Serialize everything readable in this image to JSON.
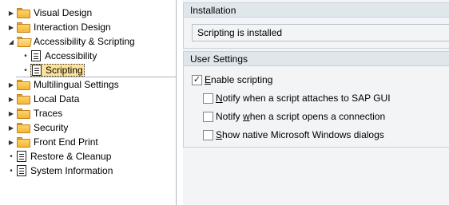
{
  "tree": {
    "items": [
      {
        "label": "Visual Design"
      },
      {
        "label": "Interaction Design"
      },
      {
        "label": "Accessibility & Scripting"
      },
      {
        "label": "Accessibility"
      },
      {
        "label": "Scripting"
      },
      {
        "label": "Multilingual Settings"
      },
      {
        "label": "Local Data"
      },
      {
        "label": "Traces"
      },
      {
        "label": "Security"
      },
      {
        "label": "Front End Print"
      },
      {
        "label": "Restore & Cleanup"
      },
      {
        "label": "System Information"
      }
    ]
  },
  "installation": {
    "title": "Installation",
    "status": "Scripting is installed"
  },
  "user_settings": {
    "title": "User Settings",
    "enable_scripting": {
      "label_first": "E",
      "label_rest": "nable scripting",
      "checked": true
    },
    "notify_attach": {
      "label_first": "N",
      "label_rest": "otify when a script attaches to SAP GUI",
      "checked": false
    },
    "notify_open": {
      "label_pre": "Notify ",
      "label_ul": "w",
      "label_rest": "hen a script opens a connection",
      "checked": false
    },
    "show_dialogs": {
      "label_first": "S",
      "label_rest": "how native Microsoft Windows dialogs",
      "checked": false
    }
  }
}
